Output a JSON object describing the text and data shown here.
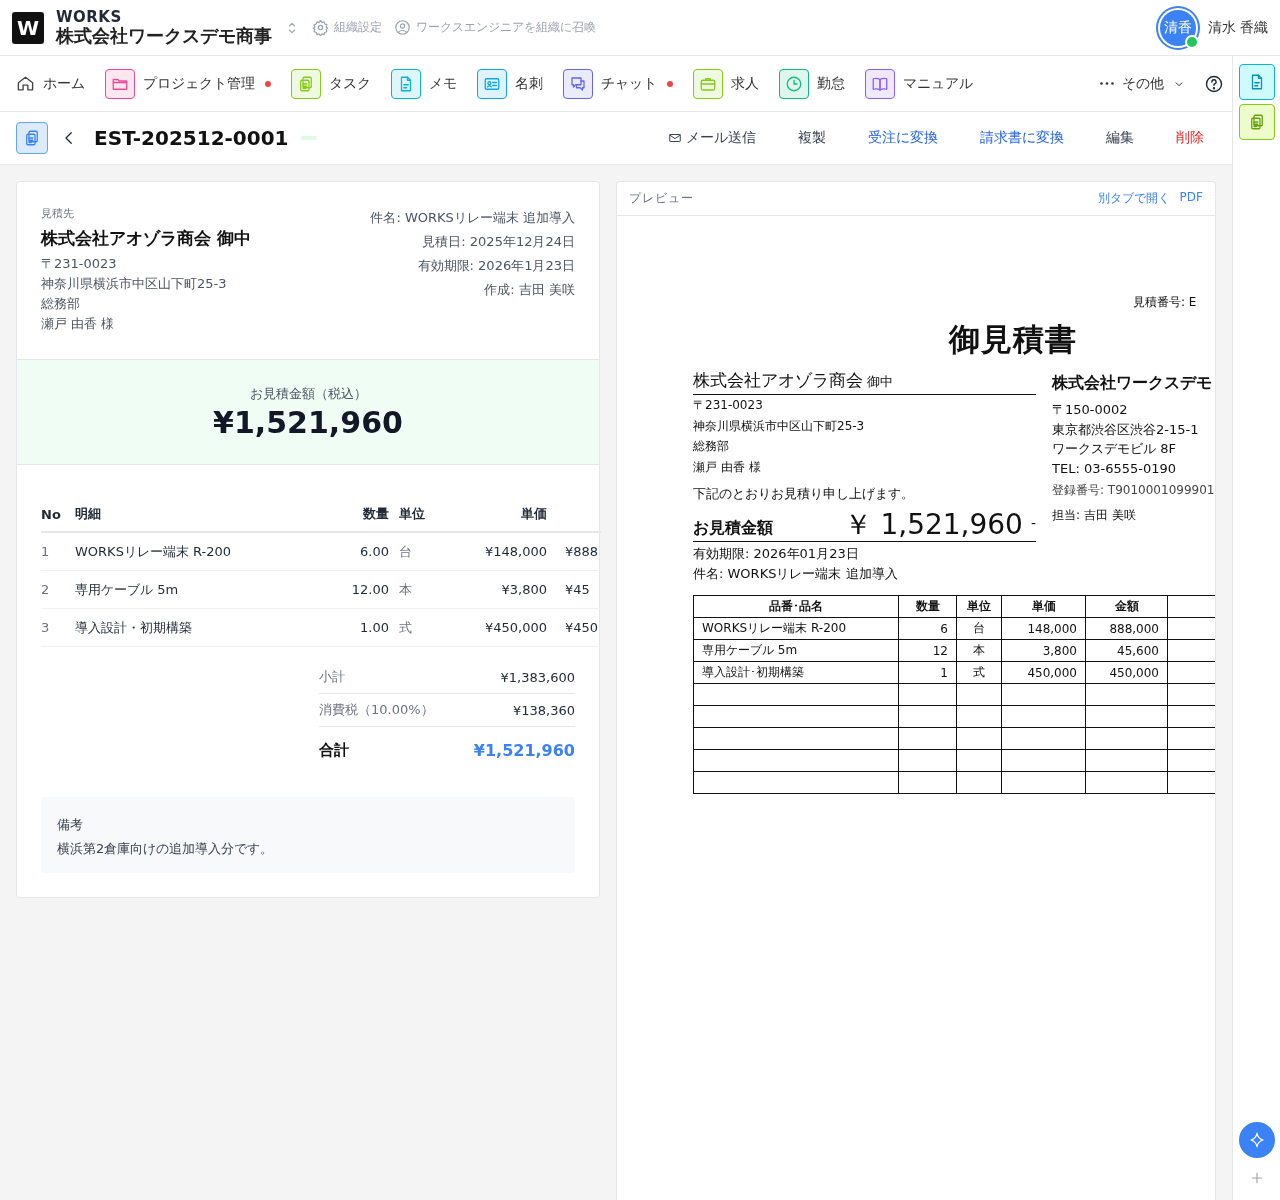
{
  "header": {
    "logo": "W",
    "brand": "WORKS",
    "org": "株式会社ワークスデモ商事",
    "links": [
      {
        "label": "組織設定",
        "kind": "settings"
      },
      {
        "label": "ワークスエンジニアを組織に召喚",
        "kind": "user"
      }
    ],
    "user": {
      "initials": "清香",
      "name": "清水 香織",
      "online": true
    }
  },
  "nav": {
    "items": [
      {
        "label": "ホーム",
        "kind": "home",
        "badge": false
      },
      {
        "label": "プロジェクト管理",
        "kind": "folder",
        "badge": true,
        "color": "#ec4899"
      },
      {
        "label": "タスク",
        "kind": "clipboard",
        "badge": false,
        "color": "#84cc16"
      },
      {
        "label": "メモ",
        "kind": "doc",
        "badge": false,
        "color": "#06b6d4"
      },
      {
        "label": "名刺",
        "kind": "card",
        "badge": false,
        "color": "#0ea5e9"
      },
      {
        "label": "チャット",
        "kind": "chat",
        "badge": true,
        "color": "#6366f1"
      },
      {
        "label": "求人",
        "kind": "briefcase",
        "badge": false,
        "color": "#84cc16"
      },
      {
        "label": "勤怠",
        "kind": "clock",
        "badge": false,
        "color": "#10b981"
      },
      {
        "label": "マニュアル",
        "kind": "book",
        "badge": false,
        "color": "#8b5cf6"
      }
    ],
    "more": "その他"
  },
  "toolbar": {
    "title": "EST-202512-0001",
    "actions": [
      {
        "label": "メール送信",
        "kind": "mail"
      },
      {
        "label": "複製",
        "kind": "plain"
      },
      {
        "label": "受注に変換",
        "kind": "link"
      },
      {
        "label": "請求書に変換",
        "kind": "link"
      },
      {
        "label": "編集",
        "kind": "plain"
      },
      {
        "label": "削除",
        "kind": "danger"
      }
    ]
  },
  "estimate": {
    "client_label": "見積先",
    "client": "株式会社アオゾラ商会 御中",
    "address": [
      "〒231-0023",
      "神奈川県横浜市中区山下町25-3",
      "総務部",
      "瀬戸 由香 様"
    ],
    "meta": [
      "件名: WORKSリレー端末 追加導入",
      "見積日: 2025年12月24日",
      "有効期限: 2026年1月23日",
      "作成: 吉田 美咲"
    ],
    "total_label": "お見積金額（税込）",
    "total": "¥1,521,960",
    "columns": [
      "No",
      "明細",
      "数量",
      "単位",
      "単価"
    ],
    "rows": [
      {
        "no": "1",
        "item": "WORKSリレー端末 R-200",
        "qty": "6.00",
        "unit": "台",
        "price": "¥148,000",
        "amount": "¥888"
      },
      {
        "no": "2",
        "item": "専用ケーブル 5m",
        "qty": "12.00",
        "unit": "本",
        "price": "¥3,800",
        "amount": "¥45"
      },
      {
        "no": "3",
        "item": "導入設計・初期構築",
        "qty": "1.00",
        "unit": "式",
        "price": "¥450,000",
        "amount": "¥450"
      }
    ],
    "summary": [
      {
        "label": "小計",
        "value": "¥1,383,600",
        "kind": "normal"
      },
      {
        "label": "消費税（10.00%）",
        "value": "¥138,360",
        "kind": "normal"
      },
      {
        "label": "合計",
        "value": "¥1,521,960",
        "kind": "total"
      }
    ],
    "notes_label": "備考",
    "notes": "横浜第2倉庫向けの追加導入分です。"
  },
  "preview": {
    "title": "プレビュー",
    "links": [
      "別タブで開く",
      "PDF"
    ],
    "doc": {
      "number": "見積番号: E",
      "title": "御見積書",
      "client": "株式会社アオゾラ商会",
      "honorific": "御中",
      "client_lines": [
        "〒231-0023",
        "神奈川県横浜市中区山下町25-3",
        "総務部",
        "瀬戸 由香 様"
      ],
      "greeting": "下記のとおりお見積り申し上げます。",
      "total_label": "お見積金額",
      "total": "￥ 1,521,960",
      "total_suffix": "-",
      "validity": "有効期限: 2026年01月23日",
      "subject": "件名: WORKSリレー端末 追加導入",
      "company": "株式会社ワークスデモ",
      "company_lines": [
        "〒150-0002",
        "東京都渋谷区渋谷2-15-1",
        "ワークスデモビル 8F",
        "TEL: 03-6555-0190"
      ],
      "registration": "登録番号: T9010001099901",
      "staff": "担当: 吉田 美咲",
      "columns": [
        "品番･品名",
        "数量",
        "単位",
        "単価",
        "金額"
      ],
      "rows": [
        {
          "item": "WORKSリレー端末 R-200",
          "qty": "6",
          "unit": "台",
          "price": "148,000",
          "amount": "888,000"
        },
        {
          "item": "専用ケーブル 5m",
          "qty": "12",
          "unit": "本",
          "price": "3,800",
          "amount": "45,600"
        },
        {
          "item": "導入設計･初期構築",
          "qty": "1",
          "unit": "式",
          "price": "450,000",
          "amount": "450,000"
        }
      ]
    }
  }
}
